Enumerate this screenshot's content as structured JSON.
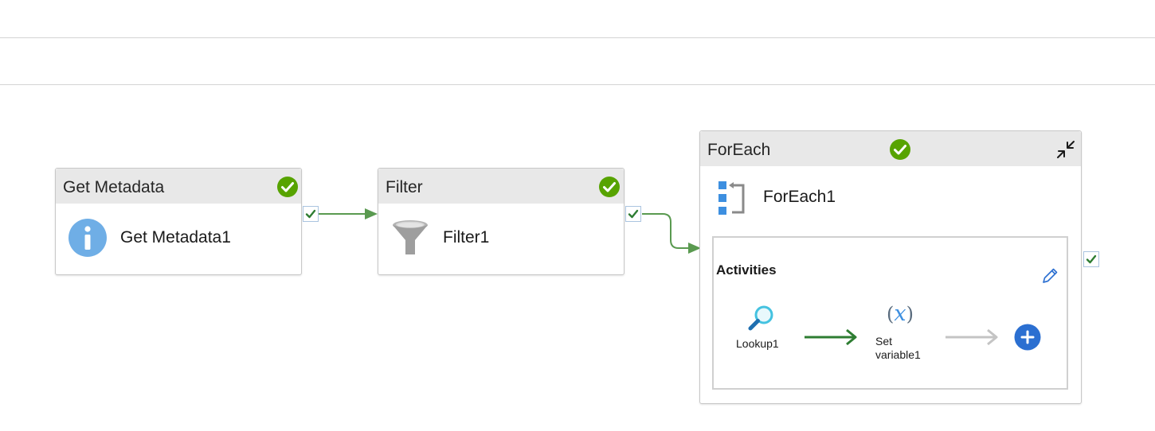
{
  "activities": [
    {
      "type": "Get Metadata",
      "name": "Get Metadata1",
      "icon": "info-icon"
    },
    {
      "type": "Filter",
      "name": "Filter1",
      "icon": "filter-funnel-icon"
    }
  ],
  "foreach": {
    "type": "ForEach",
    "name": "ForEach1",
    "icon": "foreach-loop-icon",
    "inner": {
      "title": "Activities",
      "lookup": {
        "name": "Lookup1",
        "icon": "lookup-search-icon"
      },
      "set_variable": {
        "line1": "Set",
        "line2": "variable1",
        "icon": "variable-x-icon"
      }
    }
  },
  "colors": {
    "success_green": "#57a300",
    "connector_green": "#5a9a50",
    "inner_arrow_green": "#2e7d32",
    "add_button_blue": "#2b6fd1",
    "info_blue": "#6faee6",
    "header_gray": "#e8e8e8"
  }
}
